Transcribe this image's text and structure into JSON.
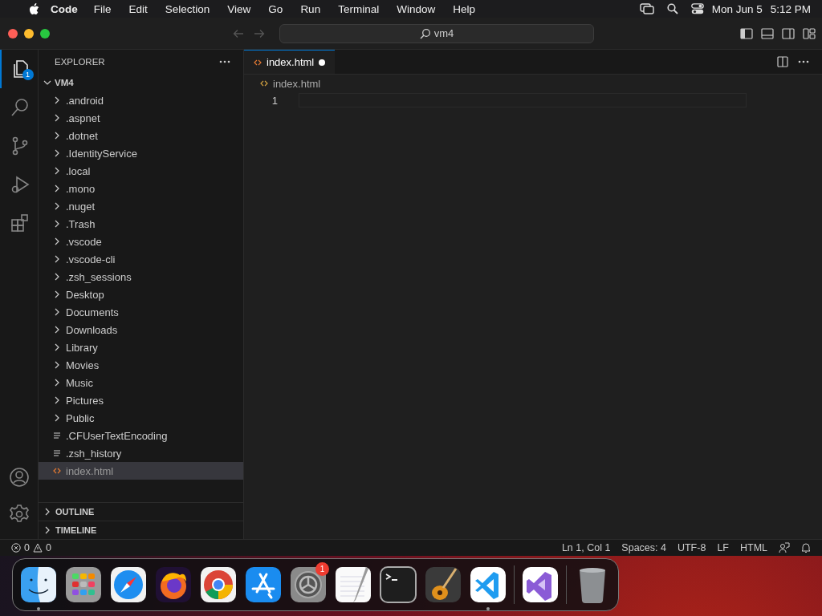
{
  "menubar": {
    "app_name": "Code",
    "menus": [
      "File",
      "Edit",
      "Selection",
      "View",
      "Go",
      "Run",
      "Terminal",
      "Window",
      "Help"
    ],
    "date": "Mon Jun 5",
    "time": "5:12 PM"
  },
  "titlebar": {
    "back_disabled": true,
    "forward_disabled": true,
    "command_center": "vm4"
  },
  "activity_bar": {
    "items": [
      {
        "kind": "explorer",
        "selected": true,
        "badge": "1"
      },
      {
        "kind": "search",
        "selected": false
      },
      {
        "kind": "source-control",
        "selected": false
      },
      {
        "kind": "run-debug",
        "selected": false
      },
      {
        "kind": "extensions",
        "selected": false
      }
    ]
  },
  "sidebar": {
    "title": "EXPLORER",
    "root": {
      "label": "VM4",
      "expanded": true
    },
    "items": [
      {
        "label": ".android",
        "kind": "folder",
        "selected": false
      },
      {
        "label": ".aspnet",
        "kind": "folder",
        "selected": false
      },
      {
        "label": ".dotnet",
        "kind": "folder",
        "selected": false
      },
      {
        "label": ".IdentityService",
        "kind": "folder",
        "selected": false
      },
      {
        "label": ".local",
        "kind": "folder",
        "selected": false
      },
      {
        "label": ".mono",
        "kind": "folder",
        "selected": false
      },
      {
        "label": ".nuget",
        "kind": "folder",
        "selected": false
      },
      {
        "label": ".Trash",
        "kind": "folder",
        "selected": false
      },
      {
        "label": ".vscode",
        "kind": "folder",
        "selected": false
      },
      {
        "label": ".vscode-cli",
        "kind": "folder",
        "selected": false
      },
      {
        "label": ".zsh_sessions",
        "kind": "folder",
        "selected": false
      },
      {
        "label": "Desktop",
        "kind": "folder",
        "selected": false
      },
      {
        "label": "Documents",
        "kind": "folder",
        "selected": false
      },
      {
        "label": "Downloads",
        "kind": "folder",
        "selected": false
      },
      {
        "label": "Library",
        "kind": "folder",
        "selected": false
      },
      {
        "label": "Movies",
        "kind": "folder",
        "selected": false
      },
      {
        "label": "Music",
        "kind": "folder",
        "selected": false
      },
      {
        "label": "Pictures",
        "kind": "folder",
        "selected": false
      },
      {
        "label": "Public",
        "kind": "folder",
        "selected": false
      },
      {
        "label": ".CFUserTextEncoding",
        "kind": "text-file",
        "selected": false
      },
      {
        "label": ".zsh_history",
        "kind": "text-file",
        "selected": false
      },
      {
        "label": "index.html",
        "kind": "html-file",
        "selected": true
      }
    ],
    "sections": [
      {
        "label": "OUTLINE",
        "expanded": false
      },
      {
        "label": "TIMELINE",
        "expanded": false
      }
    ]
  },
  "editor": {
    "tabs": [
      {
        "label": "index.html",
        "selected": true,
        "modified": true
      }
    ],
    "breadcrumb": "index.html",
    "line_numbers": [
      "1"
    ]
  },
  "status_bar": {
    "errors": "0",
    "warnings": "0",
    "items": [
      "Ln 1, Col 1",
      "Spaces: 4",
      "UTF-8",
      "LF",
      "HTML"
    ]
  },
  "dock": {
    "groups": [
      [
        {
          "kind": "finder",
          "running": true
        },
        {
          "kind": "launchpad",
          "running": false
        },
        {
          "kind": "safari",
          "running": false
        },
        {
          "kind": "firefox",
          "running": false
        },
        {
          "kind": "chrome",
          "running": false
        },
        {
          "kind": "app-store",
          "running": false
        },
        {
          "kind": "system-settings",
          "running": false,
          "badge": "1"
        },
        {
          "kind": "textedit",
          "running": false
        },
        {
          "kind": "terminal",
          "running": false
        },
        {
          "kind": "garageband",
          "running": false
        },
        {
          "kind": "vscode",
          "running": true
        }
      ],
      [
        {
          "kind": "visual-studio",
          "running": false
        }
      ],
      [
        {
          "kind": "trash",
          "running": false
        }
      ]
    ]
  }
}
